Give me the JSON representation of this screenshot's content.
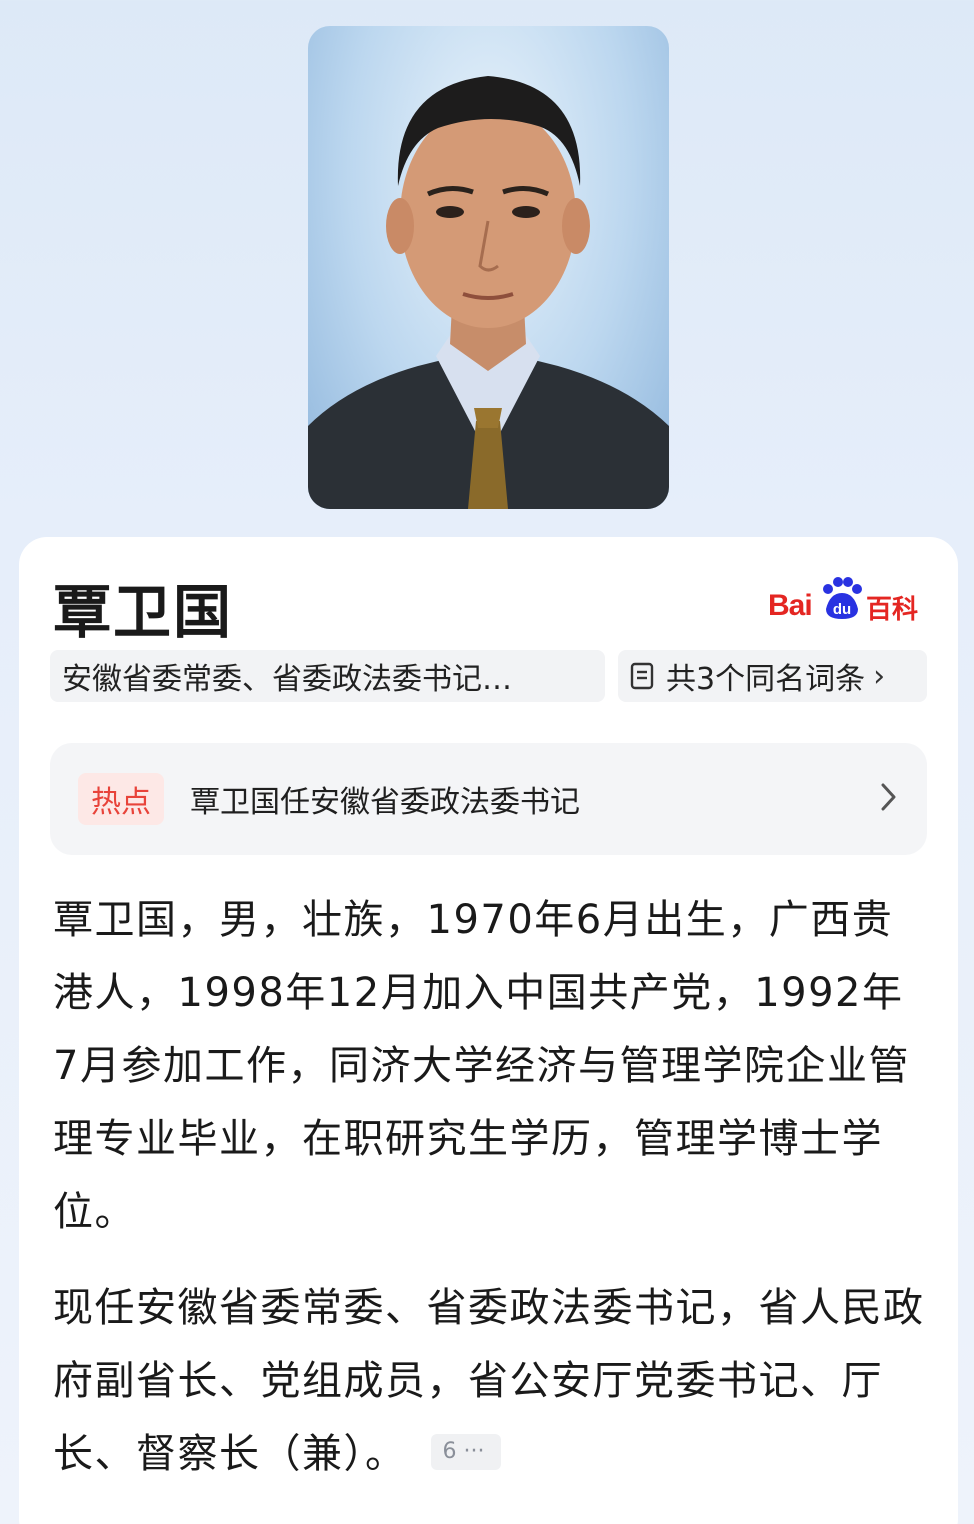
{
  "person": {
    "name": "覃卫国",
    "brief": "安徽省委常委、省委政法委书记…",
    "same_name": "共3个同名词条"
  },
  "logo": {
    "bai": "Bai",
    "du": "du",
    "baike": "百科"
  },
  "hot": {
    "tag": "热点",
    "title": "覃卫国任安徽省委政法委书记"
  },
  "paragraphs": {
    "p1": "覃卫国，男，壮族，1970年6月出生，广西贵港人，1998年12月加入中国共产党，1992年7月参加工作，同济大学经济与管理学院企业管理专业毕业，在职研究生学历，管理学博士学位。",
    "p2": "现任安徽省委常委、省委政法委书记，省人民政府副省长、党组成员，省公安厅党委书记、厅长、督察长（兼）。",
    "ref_count": "6 ···"
  },
  "colors": {
    "brand_red": "#e42622",
    "brand_blue": "#2932e1",
    "hot_tag_bg": "#fde8e6",
    "hot_tag_text": "#e8433a"
  },
  "icons": [
    "baidu-paw-icon",
    "document-icon",
    "chevron-right-icon"
  ]
}
